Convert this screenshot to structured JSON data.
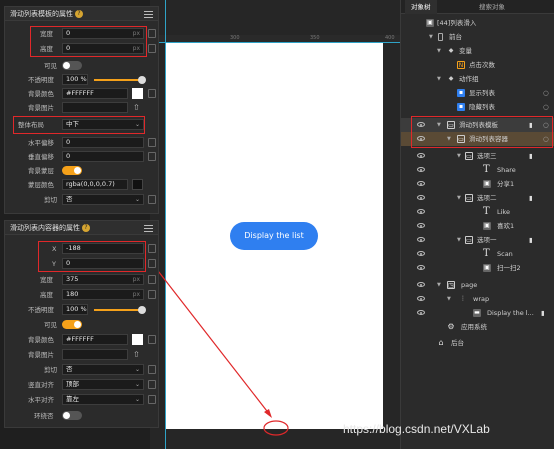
{
  "scroll_panel": {
    "title": "滑动列表模板的属性",
    "width_label": "宽度",
    "width_value": "0",
    "width_unit": "px",
    "height_label": "高度",
    "height_value": "0",
    "height_unit": "px",
    "visible_label": "可见",
    "opacity_label": "不透明度",
    "opacity_value": "100 %",
    "bg_color_label": "背景颜色",
    "bg_color_value": "#FFFFFF",
    "bg_image_label": "背景图片",
    "layout_label": "整体布局",
    "layout_value": "中下",
    "h_offset_label": "水平偏移",
    "h_offset_value": "0",
    "v_offset_label": "垂直偏移",
    "v_offset_value": "0",
    "mask_label": "背景蒙层",
    "mask_color_label": "蒙层颜色",
    "mask_color_value": "rgba(0,0,0,0.7)",
    "clip_label": "剪切",
    "clip_value": "否"
  },
  "container_panel": {
    "title": "滑动列表内容器的属性",
    "x_label": "X",
    "x_value": "-188",
    "y_label": "Y",
    "y_value": "0",
    "width_label": "宽度",
    "width_value": "375",
    "width_unit": "px",
    "height_label": "高度",
    "height_value": "180",
    "height_unit": "px",
    "opacity_label": "不透明度",
    "opacity_value": "100 %",
    "visible_label": "可见",
    "bg_color_label": "背景颜色",
    "bg_color_value": "#FFFFFF",
    "bg_image_label": "背景图片",
    "clip_label": "剪切",
    "clip_value": "否",
    "v_align_label": "竖直对齐",
    "v_align_value": "顶部",
    "h_align_label": "水平对齐",
    "h_align_value": "靠左",
    "wrap_label": "环绕否"
  },
  "canvas": {
    "ruler_labels": [
      "300",
      "350",
      "400"
    ],
    "button_label": "Display the list"
  },
  "tree": {
    "tabs": [
      "对象树",
      "搜索对象"
    ],
    "rows": [
      {
        "label": "[44]列表滑入"
      },
      {
        "label": "前台"
      },
      {
        "label": "变量"
      },
      {
        "label": "点击次数"
      },
      {
        "label": "动作组"
      },
      {
        "label": "显示列表"
      },
      {
        "label": "隐藏列表"
      },
      {
        "label": "滑动列表模板"
      },
      {
        "label": "滑动列表容器"
      },
      {
        "label": "选项三"
      },
      {
        "label": "Share"
      },
      {
        "label": "分享1"
      },
      {
        "label": "选项二"
      },
      {
        "label": "Like"
      },
      {
        "label": "喜欢1"
      },
      {
        "label": "选项一"
      },
      {
        "label": "Scan"
      },
      {
        "label": "扫一扫2"
      },
      {
        "label": "page"
      },
      {
        "label": "wrap"
      },
      {
        "label": "Display the l..."
      },
      {
        "label": "应用系统"
      },
      {
        "label": "后台"
      }
    ]
  },
  "watermark": "https://blog.csdn.net/VXLab",
  "colors": {
    "accent": "#2f7ff0",
    "highlight": "#e0282a",
    "toggle_on": "#f5a11a"
  }
}
